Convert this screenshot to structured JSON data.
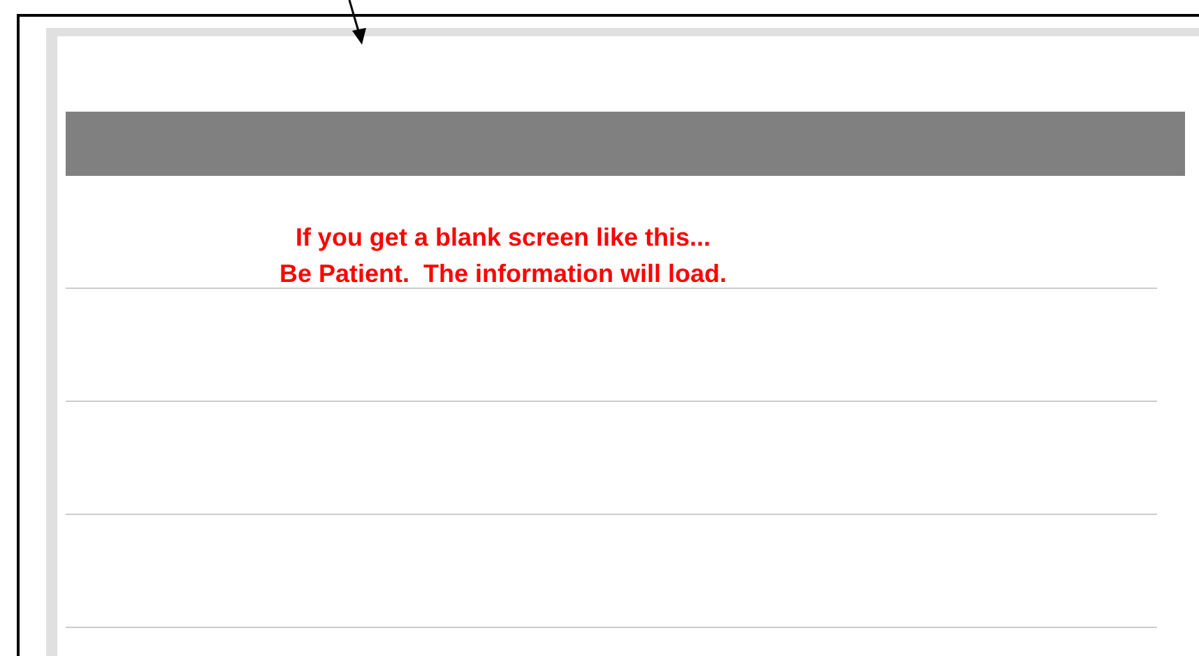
{
  "note": {
    "lines": [
      "If you get a blank screen like this...",
      "Be Patient.  The information will load."
    ]
  }
}
